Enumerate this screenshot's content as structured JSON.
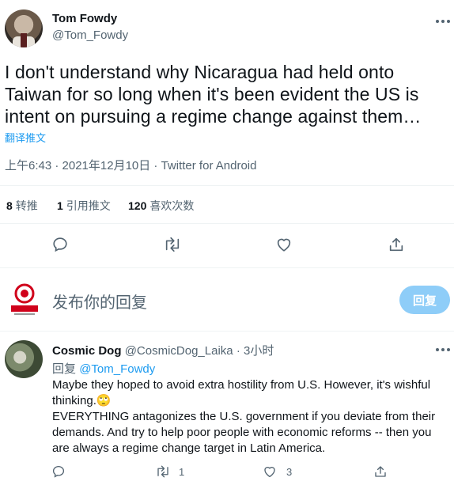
{
  "tweet": {
    "author_name": "Tom Fowdy",
    "author_handle": "@Tom_Fowdy",
    "text_line1": "I don't understand why Nicaragua had held onto",
    "text_line2": "Taiwan for so long when it's been evident the US is",
    "text_line3": "intent on pursuing a regime change against them…",
    "translate_label": "翻译推文",
    "timestamp": "上午6:43 · 2021年12月10日 · Twitter for Android"
  },
  "stats": {
    "retweets_count": "8",
    "retweets_label": "转推",
    "quotes_count": "1",
    "quotes_label": "引用推文",
    "likes_count": "120",
    "likes_label": "喜欢次数"
  },
  "compose": {
    "placeholder": "发布你的回复",
    "reply_button": "回复"
  },
  "reply": {
    "author_name": "Cosmic Dog",
    "author_handle": "@CosmicDog_Laika",
    "time": "· 3小时",
    "replying_to_prefix": "回复",
    "replying_to_handle": "@Tom_Fowdy",
    "line1": "Maybe they hoped to avoid extra hostility from U.S. However, it's wishful",
    "line2": "thinking.",
    "emoji": "🙄",
    "line3": "EVERYTHING antagonizes the U.S. government if you deviate from their",
    "line4": "demands. And try to help poor people with economic reforms -- then you",
    "line5": "are always a regime change target in Latin America.",
    "retweet_count": "1",
    "like_count": "3"
  },
  "icons": {
    "reply": "reply-icon",
    "retweet": "retweet-icon",
    "like": "heart-icon",
    "share": "share-icon",
    "more": "more-icon"
  },
  "colors": {
    "accent": "#1d9bf0",
    "reply_button_disabled": "#8ecdf8",
    "secondary_text": "#536471"
  }
}
